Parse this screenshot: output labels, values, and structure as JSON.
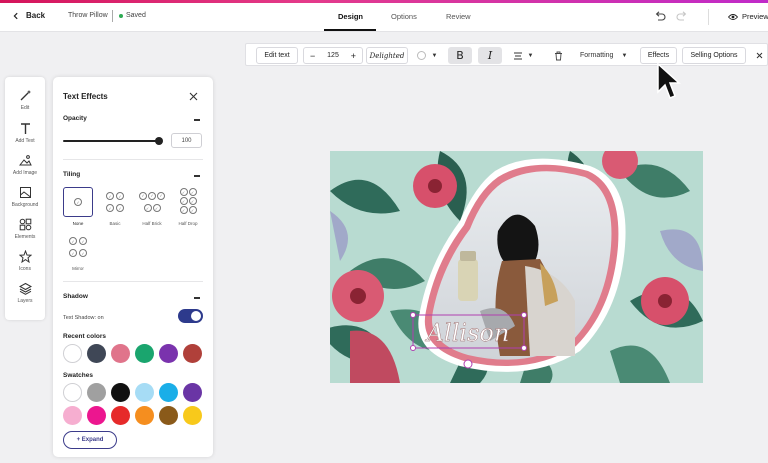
{
  "header": {
    "back_label": "Back",
    "product_name": "Throw Pillow",
    "saved_label": "Saved",
    "tabs": [
      {
        "label": "Design",
        "active": true
      },
      {
        "label": "Options",
        "active": false
      },
      {
        "label": "Review",
        "active": false
      }
    ],
    "preview_label": "Preview"
  },
  "toolbar": {
    "edit_text_label": "Edit text",
    "font_size": "125",
    "font_name": "Delighted",
    "bold_glyph": "B",
    "italic_glyph": "I",
    "formatting_label": "Formatting",
    "effects_label": "Effects",
    "selling_options_label": "Selling Options"
  },
  "rail": {
    "items": [
      {
        "label": "Edit",
        "icon": "magic-wand-icon"
      },
      {
        "label": "Add Text",
        "icon": "text-icon"
      },
      {
        "label": "Add Image",
        "icon": "image-icon"
      },
      {
        "label": "Background",
        "icon": "background-icon"
      },
      {
        "label": "Elements",
        "icon": "elements-icon"
      },
      {
        "label": "Icons",
        "icon": "star-icon"
      },
      {
        "label": "Layers",
        "icon": "layers-icon"
      }
    ]
  },
  "panel": {
    "title": "Text Effects",
    "opacity": {
      "label": "Opacity",
      "value": "100",
      "level": 1.0
    },
    "tiling": {
      "label": "Tiling",
      "options": [
        {
          "label": "None",
          "selected": true
        },
        {
          "label": "Basic",
          "selected": false
        },
        {
          "label": "Half Brick",
          "selected": false
        },
        {
          "label": "Half Drop",
          "selected": false
        },
        {
          "label": "Mirror",
          "selected": false
        }
      ]
    },
    "shadow": {
      "label": "Shadow",
      "toggle_label": "Text Shadow: on",
      "on": true
    },
    "recent_colors": {
      "label": "Recent colors",
      "colors": [
        "#ffffff",
        "#3f4756",
        "#e0748b",
        "#1aa56e",
        "#7a33ad",
        "#b0403a"
      ]
    },
    "swatches": {
      "label": "Swatches",
      "colors": [
        "#ffffff",
        "#a0a0a0",
        "#111111",
        "#a6dcf5",
        "#1aaee8",
        "#6a35a5",
        "#f6aed0",
        "#ec168f",
        "#e62a2a",
        "#f58e1f",
        "#8a5a1a",
        "#f8c91b"
      ]
    },
    "expand_label": "+ Expand"
  },
  "canvas": {
    "text": "Allison",
    "bg_color": "#b9dcd2",
    "frame_color": "#e07c8c"
  }
}
